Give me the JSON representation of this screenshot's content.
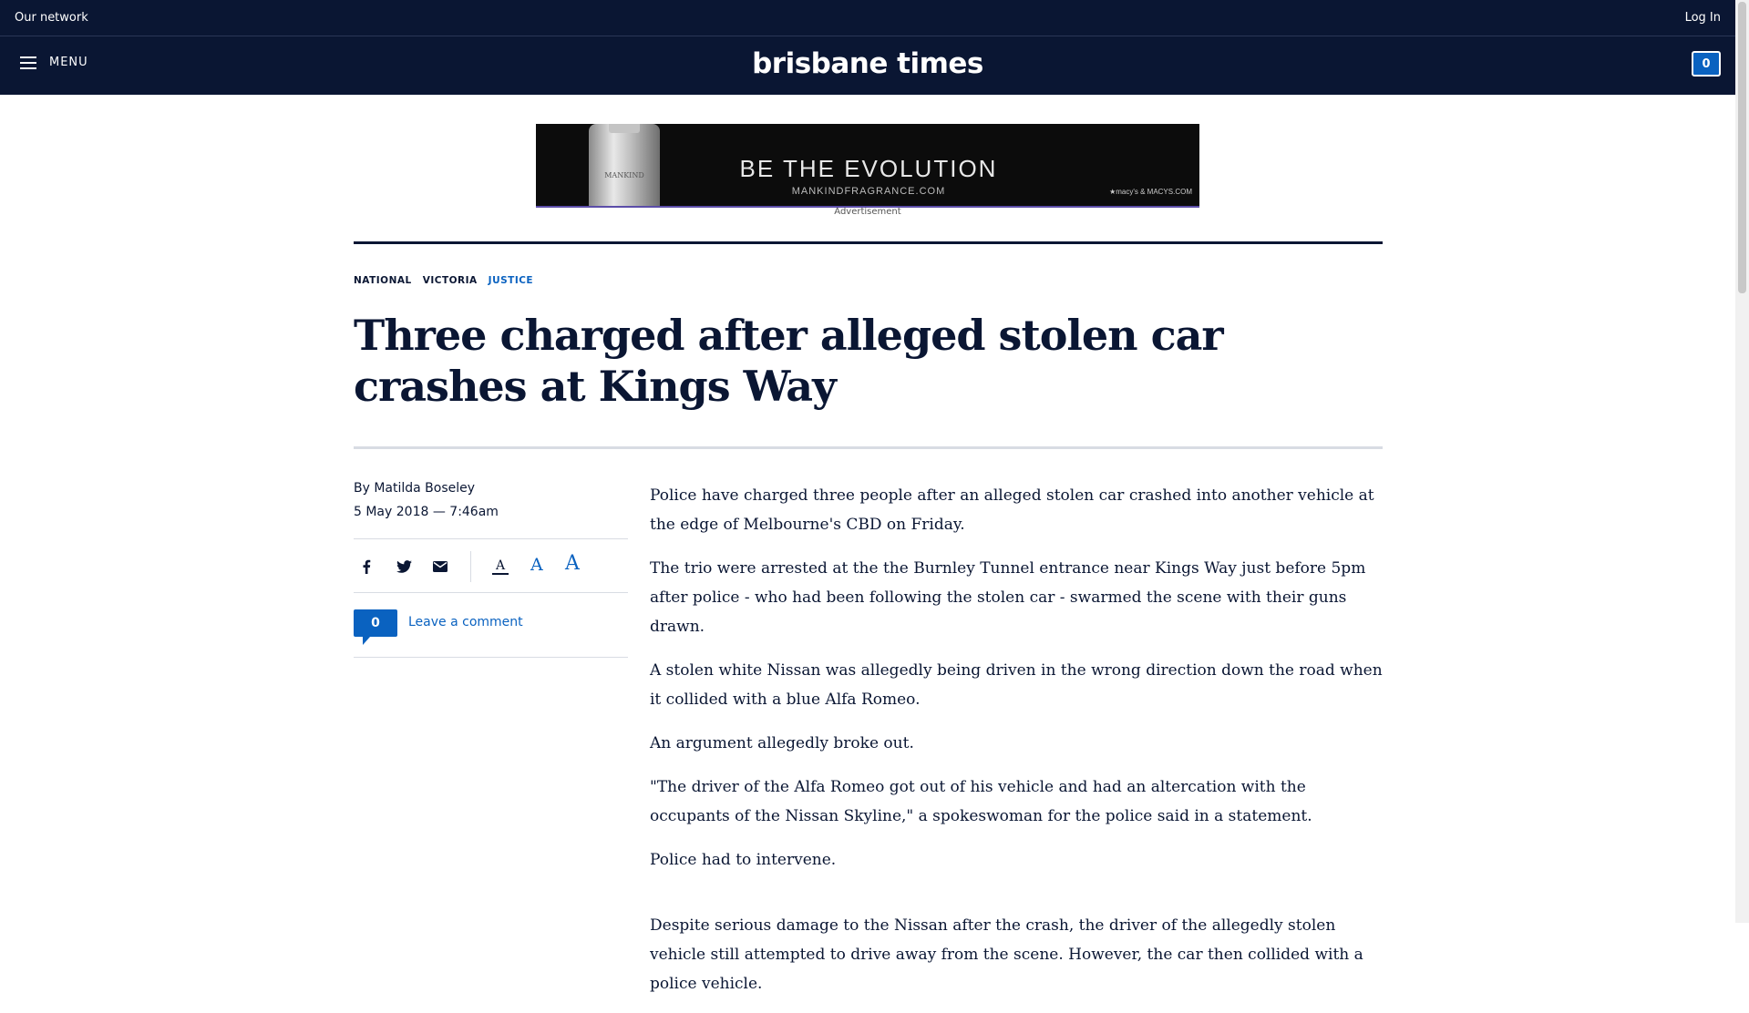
{
  "topbar": {
    "network_label": "Our network",
    "login_label": "Log In"
  },
  "header": {
    "menu_label": "MENU",
    "logo": "brisbane times",
    "comment_count": "0"
  },
  "ad": {
    "bottle_text": "MANKIND",
    "headline": "BE THE EVOLUTION",
    "site": "MANKINDFRAGRANCE.COM",
    "partner": "★macy's  & MACYS.COM",
    "label": "Advertisement"
  },
  "article": {
    "tags": [
      "NATIONAL",
      "VICTORIA",
      "JUSTICE"
    ],
    "headline": "Three charged after alleged stolen car crashes at Kings Way",
    "byline_prefix": "By",
    "author": "Matilda Boseley",
    "date": "5 May 2018 — 7:46am",
    "share_icons": [
      "facebook-icon",
      "twitter-icon",
      "email-icon"
    ],
    "font_size_glyph": "A",
    "comments_count": "0",
    "leave_comment": "Leave a comment",
    "paragraphs": [
      "Police have charged three people after an alleged stolen car crashed into another vehicle at the edge of Melbourne's CBD on Friday.",
      "The trio were arrested at the the Burnley Tunnel entrance near Kings Way just before 5pm after police - who had been following the stolen car - swarmed the scene with their guns drawn.",
      "A stolen white Nissan was allegedly being driven in the wrong direction down the road when it collided with a blue Alfa Romeo.",
      "An argument allegedly broke out.",
      "\"The driver of the Alfa Romeo got out of his vehicle and had an altercation with the occupants of the Nissan Skyline,\" a spokeswoman for the police said in a statement.",
      "Police had to intervene.",
      "Despite serious damage to the Nissan after the crash, the driver of the allegedly stolen vehicle still attempted to drive away from the scene. However, the car then collided with a police vehicle."
    ]
  },
  "colors": {
    "brand_navy": "#0a1633",
    "accent_blue": "#0a62c0"
  }
}
